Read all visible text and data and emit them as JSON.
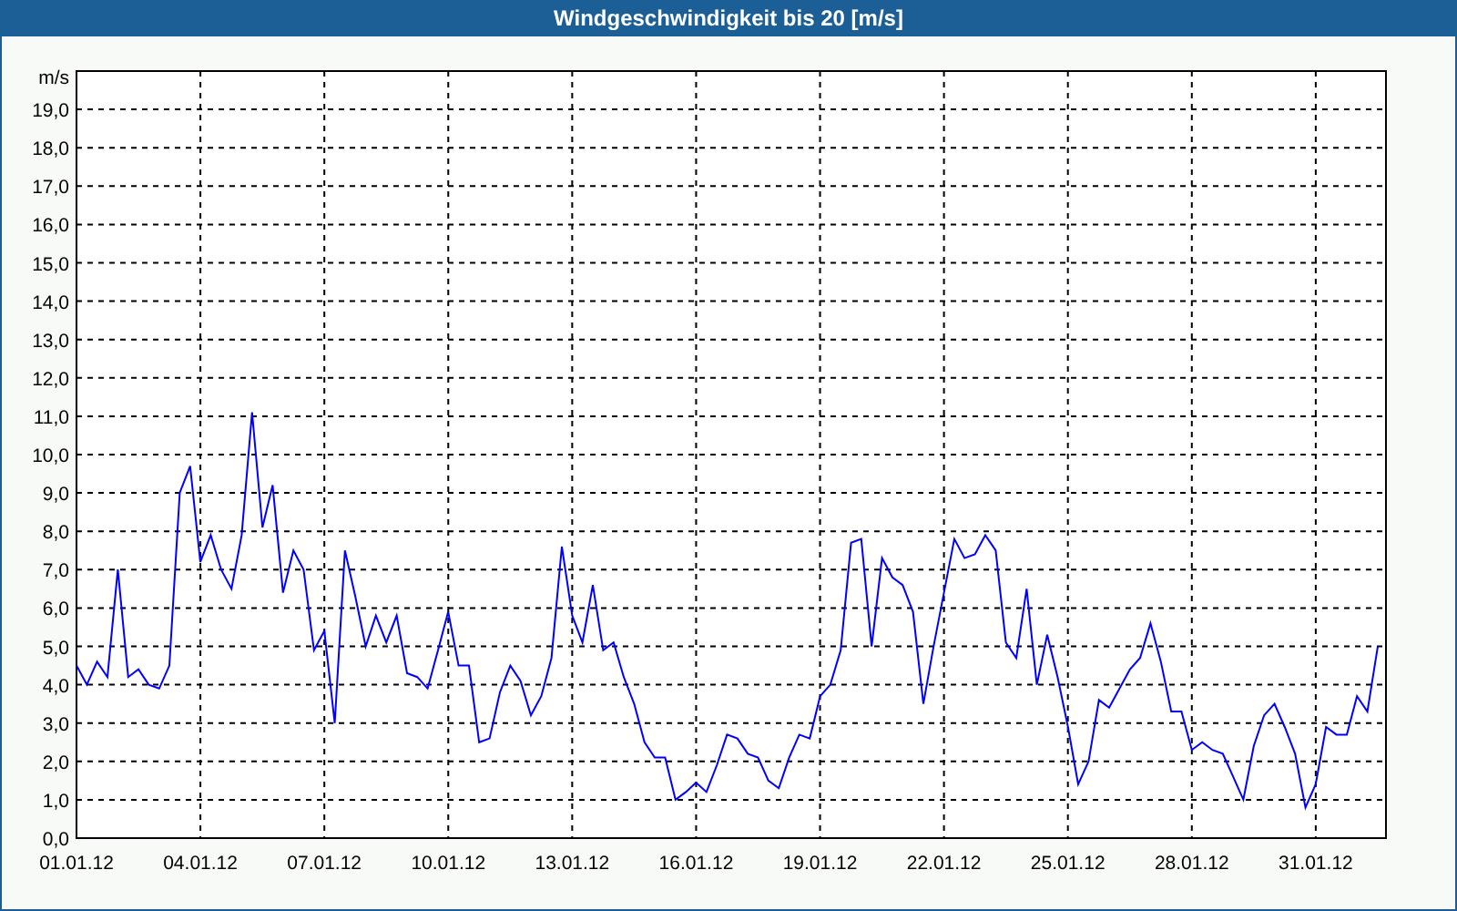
{
  "window": {
    "title": "Windgeschwindigkeit bis 20 [m/s]"
  },
  "chart": {
    "chart_data": {
      "type": "line",
      "grid": true,
      "ylabel": "m/s",
      "ylim": [
        0,
        20
      ],
      "categories": [
        "01.01.12",
        null,
        null,
        null,
        null,
        null,
        null,
        null,
        null,
        null,
        null,
        null,
        "04.01.12",
        null,
        null,
        null,
        null,
        null,
        null,
        null,
        null,
        null,
        null,
        null,
        "07.01.12",
        null,
        null,
        null,
        null,
        null,
        null,
        null,
        null,
        null,
        null,
        null,
        "10.01.12",
        null,
        null,
        null,
        null,
        null,
        null,
        null,
        null,
        null,
        null,
        null,
        "13.01.12",
        null,
        null,
        null,
        null,
        null,
        null,
        null,
        null,
        null,
        null,
        null,
        "16.01.12",
        null,
        null,
        null,
        null,
        null,
        null,
        null,
        null,
        null,
        null,
        null,
        "19.01.12",
        null,
        null,
        null,
        null,
        null,
        null,
        null,
        null,
        null,
        null,
        null,
        "22.01.12",
        null,
        null,
        null,
        null,
        null,
        null,
        null,
        null,
        null,
        null,
        null,
        "25.01.12",
        null,
        null,
        null,
        null,
        null,
        null,
        null,
        null,
        null,
        null,
        null,
        "28.01.12",
        null,
        null,
        null,
        null,
        null,
        null,
        null,
        null,
        null,
        null,
        null,
        "31.01.12",
        null,
        null,
        null,
        null,
        null,
        null
      ],
      "series": [
        {
          "color": "#0000ff",
          "values": [
            4.5,
            4.0,
            4.6,
            4.2,
            7.0,
            4.2,
            4.4,
            4.0,
            3.9,
            4.5,
            9.0,
            9.7,
            7.2,
            7.9,
            7.0,
            6.5,
            7.9,
            11.1,
            8.1,
            9.2,
            6.4,
            7.5,
            7.0,
            4.9,
            5.4,
            3.0,
            7.5,
            6.3,
            5.0,
            5.8,
            5.1,
            5.8,
            4.3,
            4.2,
            3.9,
            4.9,
            5.9,
            4.5,
            4.5,
            2.5,
            2.6,
            3.8,
            4.5,
            4.1,
            3.2,
            3.7,
            4.7,
            7.6,
            5.8,
            5.1,
            6.6,
            4.9,
            5.1,
            4.2,
            3.5,
            2.5,
            2.1,
            2.1,
            1.0,
            1.2,
            1.45,
            1.2,
            1.9,
            2.7,
            2.6,
            2.2,
            2.1,
            1.5,
            1.3,
            2.1,
            2.7,
            2.6,
            3.7,
            4.0,
            4.9,
            7.7,
            7.8,
            5.0,
            7.3,
            6.8,
            6.6,
            5.9,
            3.5,
            5.0,
            6.4,
            7.8,
            7.3,
            7.4,
            7.9,
            7.5,
            5.1,
            4.7,
            6.5,
            4.0,
            5.3,
            4.2,
            2.9,
            1.4,
            2.0,
            3.6,
            3.4,
            3.9,
            4.4,
            4.7,
            5.6,
            4.6,
            3.3,
            3.3,
            2.3,
            2.5,
            2.3,
            2.2,
            1.6,
            1.0,
            2.4,
            3.2,
            3.5,
            2.9,
            2.2,
            0.8,
            1.4,
            2.9,
            2.7,
            2.7,
            3.7,
            3.3,
            5.0
          ]
        }
      ],
      "yticks": [
        {
          "value": 0,
          "label": "0,0"
        },
        {
          "value": 1,
          "label": "1,0"
        },
        {
          "value": 2,
          "label": "2,0"
        },
        {
          "value": 3,
          "label": "3,0"
        },
        {
          "value": 4,
          "label": "4,0"
        },
        {
          "value": 5,
          "label": "5,0"
        },
        {
          "value": 6,
          "label": "6,0"
        },
        {
          "value": 7,
          "label": "7,0"
        },
        {
          "value": 8,
          "label": "8,0"
        },
        {
          "value": 9,
          "label": "9,0"
        },
        {
          "value": 10,
          "label": "10,0"
        },
        {
          "value": 11,
          "label": "11,0"
        },
        {
          "value": 12,
          "label": "12,0"
        },
        {
          "value": 13,
          "label": "13,0"
        },
        {
          "value": 14,
          "label": "14,0"
        },
        {
          "value": 15,
          "label": "15,0"
        },
        {
          "value": 16,
          "label": "16,0"
        },
        {
          "value": 17,
          "label": "17,0"
        },
        {
          "value": 18,
          "label": "18,0"
        },
        {
          "value": 19,
          "label": "19,0"
        }
      ]
    }
  }
}
